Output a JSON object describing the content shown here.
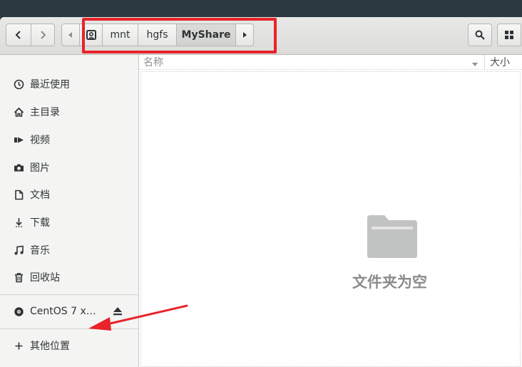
{
  "breadcrumbs": [
    "mnt",
    "hgfs",
    "MyShare"
  ],
  "sidebar": {
    "places": [
      {
        "label": "最近使用",
        "icon": "recent-icon"
      },
      {
        "label": "主目录",
        "icon": "home-icon"
      },
      {
        "label": "视频",
        "icon": "video-icon"
      },
      {
        "label": "图片",
        "icon": "camera-icon"
      },
      {
        "label": "文档",
        "icon": "document-icon"
      },
      {
        "label": "下载",
        "icon": "download-icon"
      },
      {
        "label": "音乐",
        "icon": "music-icon"
      },
      {
        "label": "回收站",
        "icon": "trash-icon"
      }
    ],
    "device": {
      "label": "CentOS 7 x…",
      "icon": "disc-icon"
    },
    "other": {
      "label": "其他位置",
      "icon": "plus-icon"
    }
  },
  "columns": {
    "name": "名称",
    "size": "大小"
  },
  "empty_message": "文件夹为空",
  "colors": {
    "highlight": "#e8232a",
    "arrow": "#e8232a"
  }
}
